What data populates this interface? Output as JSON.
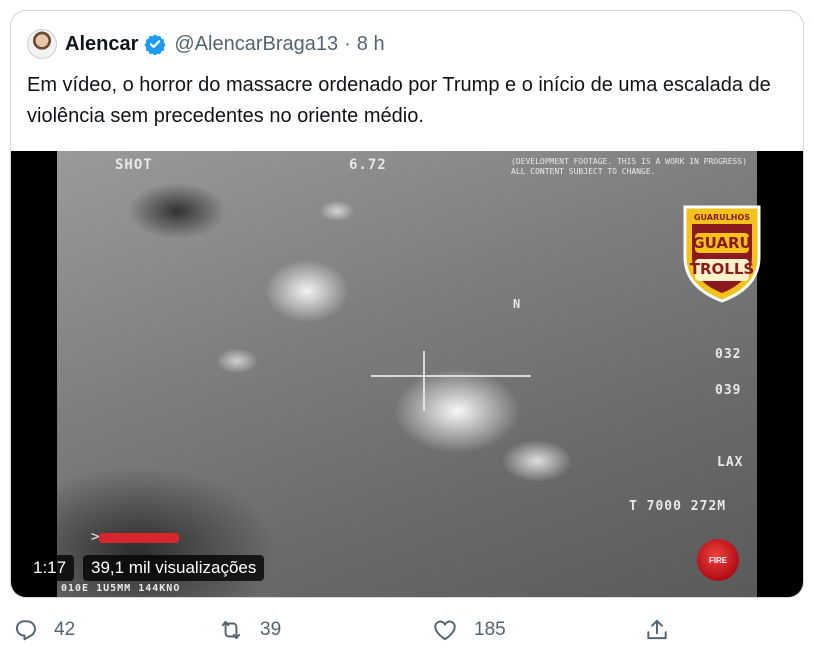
{
  "tweet": {
    "author_name": "Alencar",
    "handle": "@AlencarBraga13",
    "separator": "·",
    "time": "8 h",
    "text": "Em vídeo, o horror do massacre ordenado por Trump e o início de uma escalada de violência sem precedentes no oriente médio."
  },
  "video": {
    "duration": "1:17",
    "views": "39,1 mil visualizações",
    "overlay": {
      "top_left": "SHOT",
      "top_center": "6.72",
      "notice": "(DEVELOPMENT FOOTAGE. THIS IS A WORK IN PROGRESS) ALL CONTENT SUBJECT TO CHANGE.",
      "north": "N",
      "right_1": "032",
      "right_2": "039",
      "right_3": "LAX",
      "bottom_right": "T 7000 272M",
      "bottom_left": "010E 1U5MM 144KNO",
      "fire_button": "FIRE"
    },
    "watermark": {
      "top": "GUARULHOS",
      "middle": "GUARU",
      "bottom": "TROLLS"
    }
  },
  "actions": {
    "replies": "42",
    "retweets": "39",
    "likes": "185"
  },
  "colors": {
    "verified": "#1d9bf0",
    "secondary_text": "#536471",
    "border": "#cfd9de",
    "fire": "#d8262e"
  },
  "icons": {
    "verified": "verified-badge-icon",
    "reply": "reply-icon",
    "retweet": "retweet-icon",
    "like": "heart-icon",
    "share": "share-icon"
  }
}
